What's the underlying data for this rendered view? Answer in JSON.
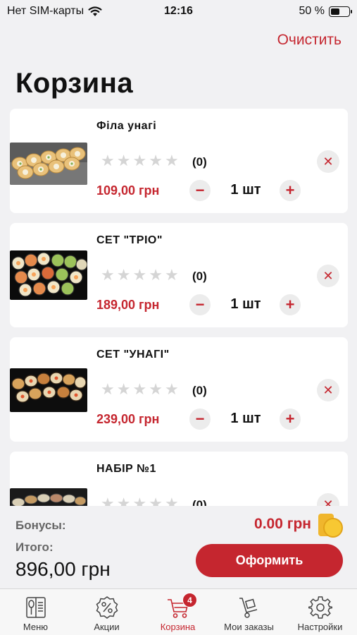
{
  "status_bar": {
    "carrier": "Нет SIM-карты",
    "time": "12:16",
    "battery": "50 %",
    "battery_level": 0.5
  },
  "header": {
    "clear_label": "Очистить",
    "title": "Корзина"
  },
  "cart": {
    "items": [
      {
        "title": "Філа унагі",
        "rating": 0,
        "rating_count": "(0)",
        "price": "109,00 грн",
        "quantity": "1 шт"
      },
      {
        "title": "СЕТ \"ТРІО\"",
        "rating": 0,
        "rating_count": "(0)",
        "price": "189,00 грн",
        "quantity": "1 шт"
      },
      {
        "title": "СЕТ \"УНАГІ\"",
        "rating": 0,
        "rating_count": "(0)",
        "price": "239,00 грн",
        "quantity": "1 шт"
      },
      {
        "title": "НАБІР №1",
        "rating": 0,
        "rating_count": "(0)"
      }
    ],
    "star_glyph": "★",
    "minus_glyph": "−",
    "plus_glyph": "+",
    "remove_glyph": "✕"
  },
  "summary": {
    "bonus_label": "Бонусы:",
    "bonus_value": "0.00 грн",
    "total_label": "Итого:",
    "total_value": "896,00 грн",
    "checkout_label": "Оформить"
  },
  "tab_bar": {
    "tabs": [
      {
        "label": "Меню",
        "icon": "menu-book-icon"
      },
      {
        "label": "Акции",
        "icon": "discount-icon"
      },
      {
        "label": "Корзина",
        "icon": "cart-icon",
        "badge": "4",
        "active": true
      },
      {
        "label": "Мои заказы",
        "icon": "hand-truck-icon"
      },
      {
        "label": "Настройки",
        "icon": "gear-icon"
      }
    ]
  },
  "colors": {
    "accent": "#c5262f",
    "background": "#f1f1f3",
    "card": "#ffffff"
  }
}
